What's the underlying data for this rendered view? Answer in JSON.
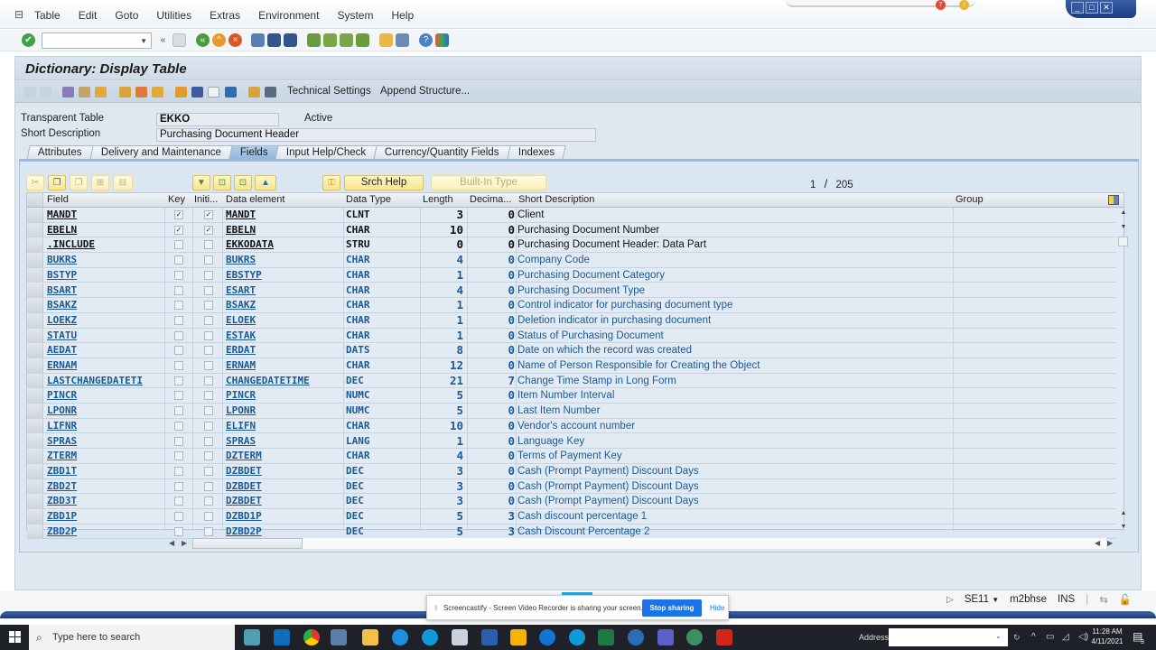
{
  "menubar": {
    "items": [
      "Table",
      "Edit",
      "Goto",
      "Utilities",
      "Extras",
      "Environment",
      "System",
      "Help"
    ]
  },
  "notification_badges": {
    "red": "7",
    "amber": "!"
  },
  "window_controls": [
    "minimize",
    "maximize",
    "close"
  ],
  "system_toolbar": {
    "command_field_value": "",
    "icons": [
      "enter-check-icon",
      "command-dropdown-icon",
      "collapse-icon",
      "save-icon",
      "back-icon",
      "exit-icon",
      "cancel-icon",
      "print-icon",
      "find-icon",
      "find-next-icon",
      "first-page-icon",
      "previous-page-icon",
      "next-page-icon",
      "last-page-icon",
      "new-session-icon",
      "shortcut-icon",
      "help-icon",
      "customize-layout-icon"
    ]
  },
  "screen": {
    "title": "Dictionary: Display Table",
    "app_toolbar": {
      "icons": [
        "back-arrow-icon",
        "forward-arrow-icon",
        "display-change-icon",
        "active-inactive-icon",
        "other-object-icon",
        "where-used-icon",
        "object-list-icon",
        "navigation-icon",
        "hierarchy-icon",
        "display-object-list-icon",
        "frame-icon",
        "info-icon",
        "layout-icon",
        "columns-icon"
      ],
      "technical_settings": "Technical Settings",
      "append_structure": "Append Structure..."
    },
    "header": {
      "table_type_label": "Transparent Table",
      "table_name": "EKKO",
      "status": "Active",
      "short_desc_label": "Short Description",
      "short_desc_value": "Purchasing Document Header"
    },
    "tabs": [
      {
        "label": "Attributes",
        "active": false
      },
      {
        "label": "Delivery and Maintenance",
        "active": false
      },
      {
        "label": "Fields",
        "active": true
      },
      {
        "label": "Input Help/Check",
        "active": false
      },
      {
        "label": "Currency/Quantity Fields",
        "active": false
      },
      {
        "label": "Indexes",
        "active": false
      }
    ],
    "grid_toolbar": {
      "edit_icons": [
        "cut-icon",
        "copy-icon",
        "paste-icon",
        "insert-row-icon",
        "delete-row-icon"
      ],
      "nav_icons": [
        "first-row-icon",
        "previous-row-icon",
        "next-row-icon",
        "last-row-icon"
      ],
      "key_icon": "foreign-key-icon",
      "srch_help": "Srch Help",
      "built_in_type": "Built-In Type",
      "pager_current": "1",
      "pager_sep": "/",
      "pager_total": "205"
    },
    "table": {
      "columns": [
        "Field",
        "Key",
        "Initi...",
        "Data element",
        "Data Type",
        "Length",
        "Decima...",
        "Short Description",
        "Group"
      ],
      "rows": [
        {
          "field": "MANDT",
          "key": true,
          "init": true,
          "element": "MANDT",
          "type": "CLNT",
          "length": "3",
          "dec": "0",
          "desc": "Client",
          "style": "black"
        },
        {
          "field": "EBELN",
          "key": true,
          "init": true,
          "element": "EBELN",
          "type": "CHAR",
          "length": "10",
          "dec": "0",
          "desc": "Purchasing Document Number",
          "style": "black"
        },
        {
          "field": ".INCLUDE",
          "key": false,
          "init": false,
          "element": "EKKODATA",
          "type": "STRU",
          "length": "0",
          "dec": "0",
          "desc": "Purchasing Document Header: Data Part",
          "style": "black"
        },
        {
          "field": "BUKRS",
          "key": false,
          "init": false,
          "element": "BUKRS",
          "type": "CHAR",
          "length": "4",
          "dec": "0",
          "desc": "Company Code",
          "style": "blue"
        },
        {
          "field": "BSTYP",
          "key": false,
          "init": false,
          "element": "EBSTYP",
          "type": "CHAR",
          "length": "1",
          "dec": "0",
          "desc": "Purchasing Document Category",
          "style": "blue"
        },
        {
          "field": "BSART",
          "key": false,
          "init": false,
          "element": "ESART",
          "type": "CHAR",
          "length": "4",
          "dec": "0",
          "desc": "Purchasing Document Type",
          "style": "blue"
        },
        {
          "field": "BSAKZ",
          "key": false,
          "init": false,
          "element": "BSAKZ",
          "type": "CHAR",
          "length": "1",
          "dec": "0",
          "desc": "Control indicator for purchasing document type",
          "style": "blue"
        },
        {
          "field": "LOEKZ",
          "key": false,
          "init": false,
          "element": "ELOEK",
          "type": "CHAR",
          "length": "1",
          "dec": "0",
          "desc": "Deletion indicator in purchasing document",
          "style": "blue"
        },
        {
          "field": "STATU",
          "key": false,
          "init": false,
          "element": "ESTAK",
          "type": "CHAR",
          "length": "1",
          "dec": "0",
          "desc": "Status of Purchasing Document",
          "style": "blue"
        },
        {
          "field": "AEDAT",
          "key": false,
          "init": false,
          "element": "ERDAT",
          "type": "DATS",
          "length": "8",
          "dec": "0",
          "desc": "Date on which the record was created",
          "style": "blue"
        },
        {
          "field": "ERNAM",
          "key": false,
          "init": false,
          "element": "ERNAM",
          "type": "CHAR",
          "length": "12",
          "dec": "0",
          "desc": "Name of Person Responsible for Creating the Object",
          "style": "blue"
        },
        {
          "field": "LASTCHANGEDATETI",
          "key": false,
          "init": false,
          "element": "CHANGEDATETIME",
          "type": "DEC",
          "length": "21",
          "dec": "7",
          "desc": "Change Time Stamp in Long Form",
          "style": "blue"
        },
        {
          "field": "PINCR",
          "key": false,
          "init": false,
          "element": "PINCR",
          "type": "NUMC",
          "length": "5",
          "dec": "0",
          "desc": "Item Number Interval",
          "style": "blue"
        },
        {
          "field": "LPONR",
          "key": false,
          "init": false,
          "element": "LPONR",
          "type": "NUMC",
          "length": "5",
          "dec": "0",
          "desc": "Last Item Number",
          "style": "blue"
        },
        {
          "field": "LIFNR",
          "key": false,
          "init": false,
          "element": "ELIFN",
          "type": "CHAR",
          "length": "10",
          "dec": "0",
          "desc": "Vendor's account number",
          "style": "blue"
        },
        {
          "field": "SPRAS",
          "key": false,
          "init": false,
          "element": "SPRAS",
          "type": "LANG",
          "length": "1",
          "dec": "0",
          "desc": "Language Key",
          "style": "blue"
        },
        {
          "field": "ZTERM",
          "key": false,
          "init": false,
          "element": "DZTERM",
          "type": "CHAR",
          "length": "4",
          "dec": "0",
          "desc": "Terms of Payment Key",
          "style": "blue"
        },
        {
          "field": "ZBD1T",
          "key": false,
          "init": false,
          "element": "DZBDET",
          "type": "DEC",
          "length": "3",
          "dec": "0",
          "desc": "Cash (Prompt Payment) Discount Days",
          "style": "blue"
        },
        {
          "field": "ZBD2T",
          "key": false,
          "init": false,
          "element": "DZBDET",
          "type": "DEC",
          "length": "3",
          "dec": "0",
          "desc": "Cash (Prompt Payment) Discount Days",
          "style": "blue"
        },
        {
          "field": "ZBD3T",
          "key": false,
          "init": false,
          "element": "DZBDET",
          "type": "DEC",
          "length": "3",
          "dec": "0",
          "desc": "Cash (Prompt Payment) Discount Days",
          "style": "blue"
        },
        {
          "field": "ZBD1P",
          "key": false,
          "init": false,
          "element": "DZBD1P",
          "type": "DEC",
          "length": "5",
          "dec": "3",
          "desc": "Cash discount percentage 1",
          "style": "blue"
        },
        {
          "field": "ZBD2P",
          "key": false,
          "init": false,
          "element": "DZBD2P",
          "type": "DEC",
          "length": "5",
          "dec": "3",
          "desc": "Cash Discount Percentage 2",
          "style": "blue"
        }
      ]
    }
  },
  "status_bar": {
    "transaction": "SE11",
    "system": "m2bhse",
    "mode": "INS"
  },
  "screencastify": {
    "message": "Screencastify - Screen Video Recorder is sharing your screen.",
    "stop_label": "Stop sharing",
    "hide_label": "Hide"
  },
  "taskbar": {
    "search_placeholder": "Type here to search",
    "apps": [
      "task-view",
      "outlook",
      "chrome",
      "sap-logon",
      "file-explorer",
      "internet-explorer",
      "skype",
      "sap-gui",
      "word",
      "presentation",
      "dell-app",
      "webex",
      "excel",
      "chat-app",
      "teams",
      "edge-app",
      "acrobat"
    ],
    "address_label": "Address",
    "address_value": "",
    "time": "11:28 AM",
    "date": "4/11/2021",
    "notification_count": "3"
  },
  "colors": {
    "link_blue": "#1a5a96",
    "black_text": "#111111",
    "tab_active": "#9cbde0",
    "button_yellow": "#f6e48c",
    "panel_bg": "#dae6f1"
  }
}
